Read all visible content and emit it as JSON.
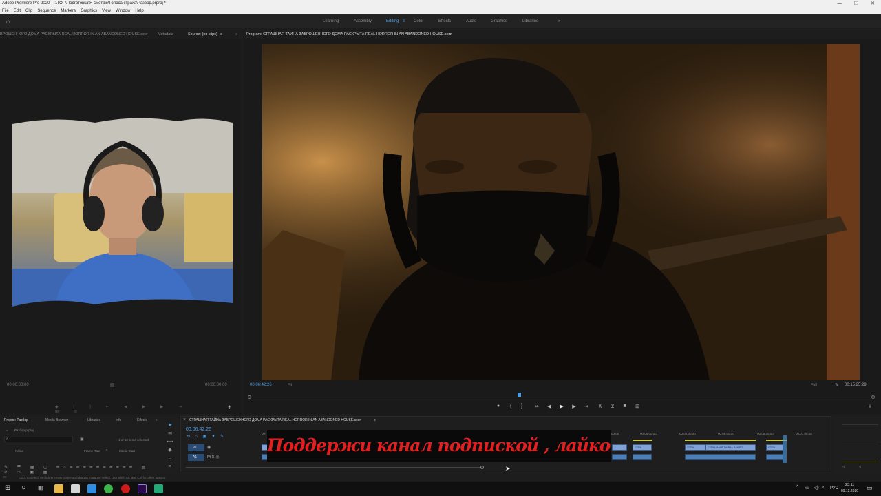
{
  "app": {
    "title": "Adobe Premiere Pro 2020 - I:\\ТОП\\Подготовка\\Я смотрю\\Голоса страха\\Разбор.prproj *"
  },
  "menu": [
    "File",
    "Edit",
    "Clip",
    "Sequence",
    "Markers",
    "Graphics",
    "View",
    "Window",
    "Help"
  ],
  "workspaces": {
    "items": [
      "Learning",
      "Assembly",
      "Editing",
      "Color",
      "Effects",
      "Audio",
      "Graphics",
      "Libraries"
    ],
    "active": "Editing",
    "more": "»"
  },
  "source_panel": {
    "tabs": [
      "ВРОШЕННОГО ДОМА РАСКРЫТА REAL HORROR IN AN ABANDONED HOUSE.scer",
      "Metadata",
      "Source: (no clips)"
    ],
    "menu_icon": "≡",
    "overflow": "»",
    "timecode_left": "00:00:00:00",
    "timecode_right": "00:00:00:00"
  },
  "program_panel": {
    "title": "Program: СТРАШНАЯ ТАЙНА ЗАБРОШЕННОГО ДОМА РАСКРЫТА REAL HORROR IN AN ABANDONED HOUSE.scer",
    "menu_icon": "≡",
    "timecode": "00:06:42:26",
    "fit": "Fit",
    "resolution": "Full",
    "duration": "00:15:25:29"
  },
  "project_panel": {
    "tabs": [
      "Project: Разбор",
      "Media Browser",
      "Libraries",
      "Info",
      "Effects"
    ],
    "overflow": "»",
    "file": "Разбор.prproj",
    "items_selected": "1 of 13 items selected",
    "columns": [
      "Name",
      "Frame Rate",
      "Media Start"
    ],
    "search_placeholder": "",
    "sort_icon": "^"
  },
  "timeline": {
    "tab": "СТРАШНАЯ ТАЙНА ЗАБРОШЕННОГО ДОМА РАСКРЫТА REAL HORROR IN AN ABANDONED HOUSE.scer",
    "menu_icon": "≡",
    "close": "×",
    "timecode": "00:06:42:26",
    "ruler": [
      "00:",
      "00:00",
      "00:05:00:00",
      "00:05:30:00",
      "00:06:00:00",
      "00:06:30:00",
      "00:07:00:00"
    ],
    "tracks": [
      "V1",
      "A1"
    ],
    "clips": [
      "СТРА",
      "СТРА",
      "СТРАШНАЯ ТАЙНА ЗАБРО",
      "СТРА"
    ],
    "banner_text": "Поддержи канал подпиской , лайком и коментарием"
  },
  "status": {
    "hint": "Click to select, or click in empty space and drag to marquee select. Use Shift, Alt, and Ctrl for other options."
  },
  "taskbar": {
    "time": "23:11",
    "date": "09.12.2020",
    "lang": "РУС"
  },
  "colors": {
    "accent": "#4a9ee8",
    "banner_red": "#e02020",
    "clip_blue": "#7fa3d9"
  }
}
